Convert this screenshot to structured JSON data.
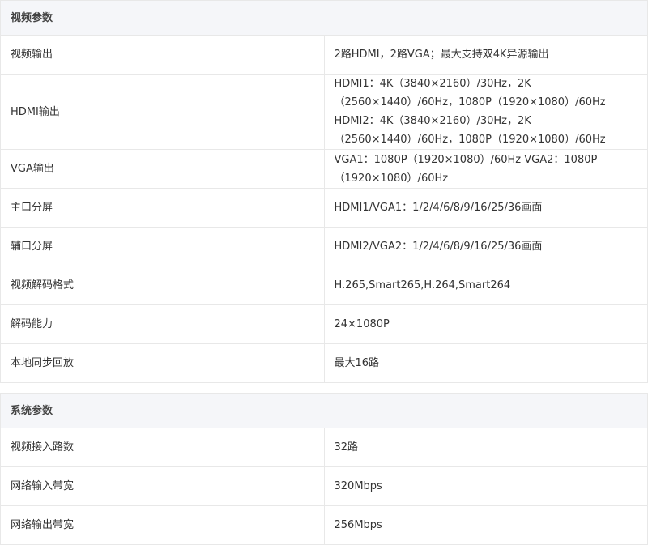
{
  "sections": [
    {
      "title": "视频参数",
      "rows": [
        {
          "key": "视频输出",
          "value": "2路HDMI，2路VGA；最大支持双4K异源输出"
        },
        {
          "key": "HDMI输出",
          "value": "HDMI1：4K（3840×2160）/30Hz，2K（2560×1440）/60Hz，1080P（1920×1080）/60Hz HDMI2：4K（3840×2160）/30Hz，2K（2560×1440）/60Hz，1080P（1920×1080）/60Hz"
        },
        {
          "key": "VGA输出",
          "value": "VGA1：1080P（1920×1080）/60Hz VGA2：1080P（1920×1080）/60Hz"
        },
        {
          "key": "主口分屏",
          "value": "HDMI1/VGA1：1/2/4/6/8/9/16/25/36画面"
        },
        {
          "key": "辅口分屏",
          "value": "HDMI2/VGA2：1/2/4/6/8/9/16/25/36画面"
        },
        {
          "key": "视频解码格式",
          "value": "H.265,Smart265,H.264,Smart264"
        },
        {
          "key": "解码能力",
          "value": "24×1080P"
        },
        {
          "key": "本地同步回放",
          "value": "最大16路"
        }
      ]
    },
    {
      "title": "系统参数",
      "rows": [
        {
          "key": "视频接入路数",
          "value": "32路"
        },
        {
          "key": "网络输入带宽",
          "value": "320Mbps"
        },
        {
          "key": "网络输出带宽",
          "value": "256Mbps"
        }
      ]
    }
  ]
}
